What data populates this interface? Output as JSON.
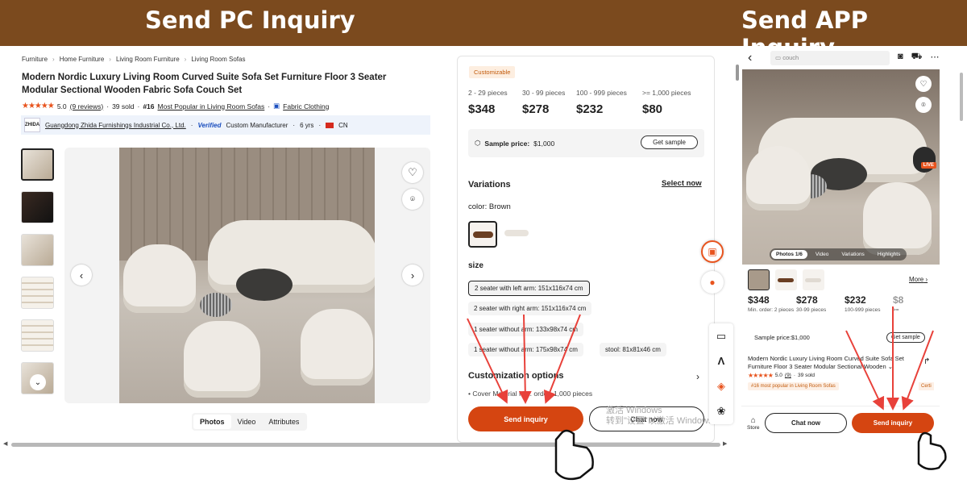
{
  "banner": {
    "pc_title": "Send PC Inquiry",
    "app_title": "Send APP Inquiry"
  },
  "pc": {
    "breadcrumb": [
      "Furniture",
      "Home Furniture",
      "Living Room Furniture",
      "Living Room Sofas"
    ],
    "title": "Modern Nordic Luxury Living Room Curved Suite Sofa Set Furniture Floor 3 Seater Modular Sectional Wooden Fabric Sofa Couch Set",
    "rating": {
      "stars": "★★★★★",
      "score": "5.0",
      "reviews": "(9 reviews)",
      "sold": "39 sold",
      "rank_num": "#16",
      "rank_text": "Most Popular in Living Room Sofas",
      "tag": "Fabric Clothing"
    },
    "supplier": {
      "logo": "ZHIDA",
      "name": "Guangdong Zhida Furnishings Industrial Co., Ltd.",
      "verified": "Verified",
      "type": "Custom Manufacturer",
      "years": "6 yrs",
      "country": "CN"
    },
    "media_tabs": [
      "Photos",
      "Video",
      "Attributes"
    ],
    "panel": {
      "badge": "Customizable",
      "tiers": [
        {
          "qty": "2 - 29 pieces",
          "price": "$348"
        },
        {
          "qty": "30 - 99 pieces",
          "price": "$278"
        },
        {
          "qty": "100 - 999 pieces",
          "price": "$232"
        },
        {
          "qty": ">= 1,000 pieces",
          "price": "$80"
        }
      ],
      "sample_label": "Sample price:",
      "sample_value": "$1,000",
      "sample_button": "Get sample",
      "variations_title": "Variations",
      "select_now": "Select now",
      "color_label": "color: Brown",
      "size_label": "size",
      "sizes": [
        "2 seater with left arm: 151x116x74 cm",
        "2 seater with right arm: 151x116x74 cm",
        "1 seater without arm: 133x98x74 cm",
        "1 seater without arm: 175x98x74 cm",
        "stool: 81x81x46 cm"
      ],
      "customization_title": "Customization options",
      "customization_item": "Cover Material  Min. order: 1,000 pieces",
      "send_inquiry": "Send inquiry",
      "chat_now": "Chat now"
    },
    "watermark": [
      "激活 Windows",
      "转到\"设置\"以激活 Windows。"
    ]
  },
  "app": {
    "search_placeholder": "couch",
    "live": "LIVE",
    "photo_tabs": [
      "Photos 1/6",
      "Video",
      "Variations",
      "Highlights"
    ],
    "more": "More",
    "tiers": [
      {
        "price": "$348",
        "qty": "Min. order: 2 pieces"
      },
      {
        "price": "$278",
        "qty": "30-99 pieces"
      },
      {
        "price": "$232",
        "qty": "100-999 pieces"
      },
      {
        "price": "$8",
        "qty": ">="
      }
    ],
    "sample_text": "Sample price:$1,000",
    "sample_button": "Get sample",
    "title": "Modern Nordic Luxury Living Room Curved Suite Sofa Set Furniture Floor 3 Seater Modular Sectional Wooden",
    "rating": {
      "stars": "★★★★★",
      "score": "5.0",
      "reviews": "(9)",
      "sold": "39 sold"
    },
    "rank": "#16 most popular in Living Room Sofas",
    "cert": "Certi",
    "store": "Store",
    "chat_now": "Chat now",
    "send_inquiry": "Send inquiry"
  },
  "colors": {
    "banner": "#7b4a1e",
    "accent": "#d54511",
    "arrow": "#e8413a"
  }
}
